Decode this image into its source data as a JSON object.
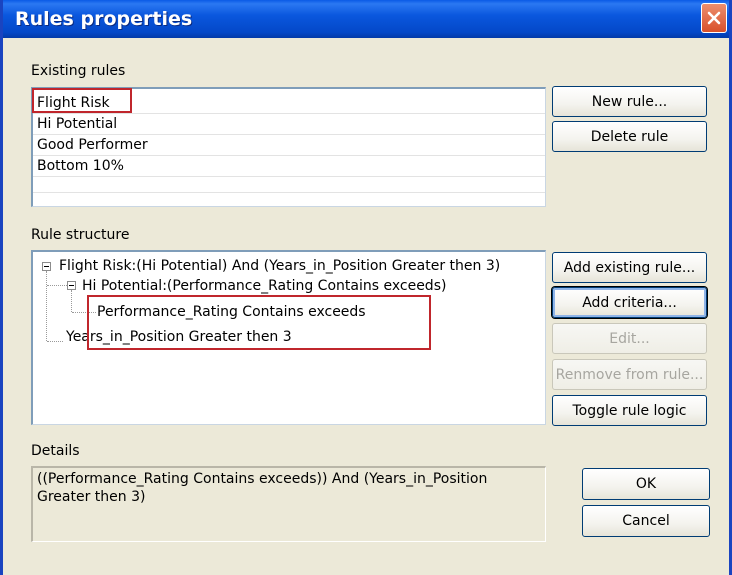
{
  "window": {
    "title": "Rules properties"
  },
  "existing_rules": {
    "label": "Existing rules",
    "items": [
      "Flight Risk",
      "Hi Potential",
      "Good Performer",
      "Bottom 10%"
    ],
    "selected": "Flight Risk"
  },
  "rule_buttons": {
    "new_rule": "New rule...",
    "delete_rule": "Delete rule"
  },
  "rule_structure": {
    "label": "Rule structure",
    "tree": {
      "root": "Flight Risk:(Hi Potential) And (Years_in_Position Greater then 3)",
      "child": "Hi Potential:(Performance_Rating Contains exceeds)",
      "grandchild": "Performance_Rating Contains exceeds",
      "sibling": "Years_in_Position Greater then 3"
    }
  },
  "structure_buttons": {
    "add_existing_rule": "Add existing rule...",
    "add_criteria": "Add criteria...",
    "edit": "Edit...",
    "remove_from_rule": "Renmove from rule...",
    "toggle_rule_logic": "Toggle rule logic"
  },
  "details": {
    "label": "Details",
    "text": "((Performance_Rating Contains exceeds)) And (Years_in_Position Greater then 3)"
  },
  "dialog_buttons": {
    "ok": "OK",
    "cancel": "Cancel"
  },
  "colors": {
    "titlebar": "#0a57de",
    "highlight": "#c0262c",
    "dialog_bg": "#ece9d8"
  },
  "icons": {
    "close": "close-icon",
    "tree_collapse": "minus-expander-icon"
  }
}
